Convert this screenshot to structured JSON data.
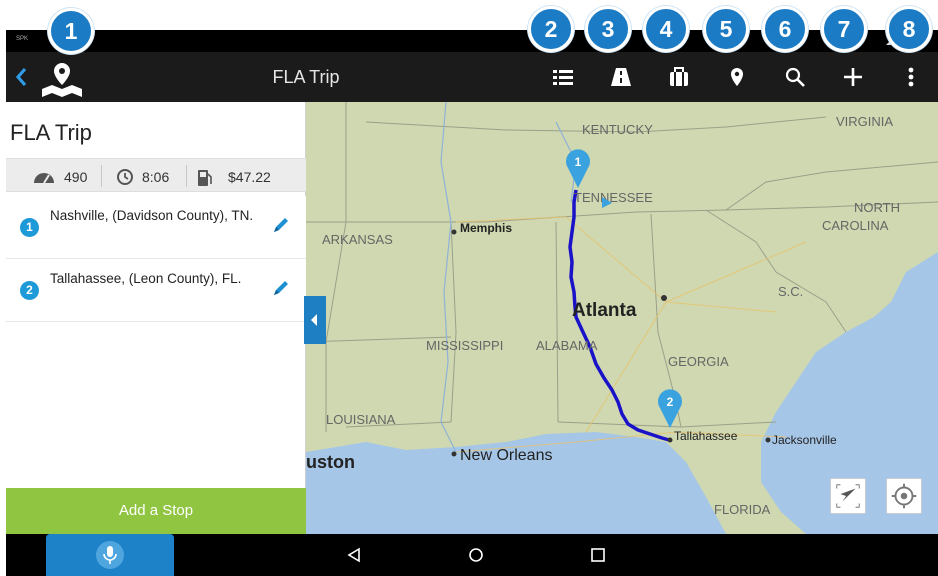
{
  "status": {
    "carrier": "SPK"
  },
  "toolbar": {
    "title": "FLA Trip"
  },
  "callouts": [
    "1",
    "2",
    "3",
    "4",
    "5",
    "6",
    "7",
    "8"
  ],
  "toolbar_icons": [
    "itinerary-list-icon",
    "road-icon",
    "briefcase-icon",
    "map-pin-icon",
    "search-icon",
    "plus-icon",
    "overflow-menu-icon"
  ],
  "trip": {
    "title": "FLA Trip",
    "distance": "490",
    "time": "8:06",
    "cost": "$47.22"
  },
  "stops": [
    {
      "number": "1",
      "name": "Nashville, (Davidson County), TN."
    },
    {
      "number": "2",
      "name": "Tallahassee, (Leon County), FL."
    }
  ],
  "add_stop_label": "Add a Stop",
  "map": {
    "labels": {
      "kentucky": "KENTUCKY",
      "virginia": "VIRGINIA",
      "tennessee": "TENNESSEE",
      "north": "NORTH",
      "carolina": "CAROLINA",
      "arkansas": "ARKANSAS",
      "memphis": "Memphis",
      "sc": "S.C.",
      "atlanta": "Atlanta",
      "mississippi": "MISSISSIPPI",
      "alabama": "ALABAMA",
      "georgia": "GEORGIA",
      "louisiana": "LOUISIANA",
      "tallahassee": "Tallahassee",
      "jacksonville": "Jacksonville",
      "houston": "uston",
      "new_orleans": "New Orleans",
      "florida": "FLORIDA"
    },
    "pins": [
      "1",
      "2"
    ],
    "route_color": "#1a12c8"
  },
  "colors": {
    "accent": "#1b7bc4",
    "toolbar": "#1b1b1b",
    "add_stop": "#8fc540",
    "stop_number": "#1e9ad8",
    "water": "#a6c6e8",
    "land": "#cfd8b0"
  }
}
